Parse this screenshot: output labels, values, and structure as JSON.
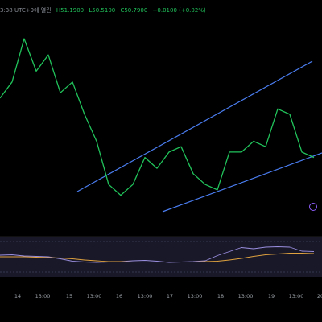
{
  "header": {
    "time_text": "3:38 UTC+9에 열린",
    "h_text": "H51.1900",
    "l_text": "L50.5100",
    "c_text": "C50.7900",
    "chg_text": "+0.0100 (+0.02%)"
  },
  "time_labels": [
    "14",
    "13:00",
    "15",
    "13:00",
    "16",
    "13:00",
    "17",
    "13:00",
    "18",
    "13:00",
    "19",
    "13:00",
    "20"
  ],
  "colors": {
    "price": "#21c35b",
    "trendline": "#4a7df0",
    "rsi": "#9a8fe0",
    "rsi_ma": "#e0a23f",
    "pane_bg": "#181828",
    "level": "#5a5a7a"
  },
  "chart_data": {
    "type": "line",
    "series": [
      {
        "values": [
          52.2,
          52.5,
          53.3,
          52.7,
          53.0,
          52.3,
          52.5,
          51.9,
          51.4,
          50.6,
          50.4,
          50.6,
          51.1,
          50.9,
          51.2,
          51.3,
          50.8,
          50.6,
          50.5,
          51.2,
          51.2,
          51.4,
          51.3,
          52.0,
          51.9,
          51.2,
          51.1
        ]
      }
    ],
    "rsi": [
      54,
      55,
      52,
      51,
      50,
      45,
      39,
      37,
      36,
      37,
      38,
      40,
      41,
      39,
      36,
      37,
      38,
      40,
      53,
      63,
      73,
      70,
      74,
      75,
      74,
      64,
      63
    ],
    "rsi_ma": [
      50,
      50,
      50,
      49,
      48,
      47,
      45,
      42,
      40,
      38,
      38,
      37,
      37,
      37,
      37,
      37,
      37,
      38,
      39,
      42,
      46,
      51,
      55,
      57,
      59,
      59,
      58
    ],
    "rsi_levels": [
      70,
      30
    ]
  }
}
